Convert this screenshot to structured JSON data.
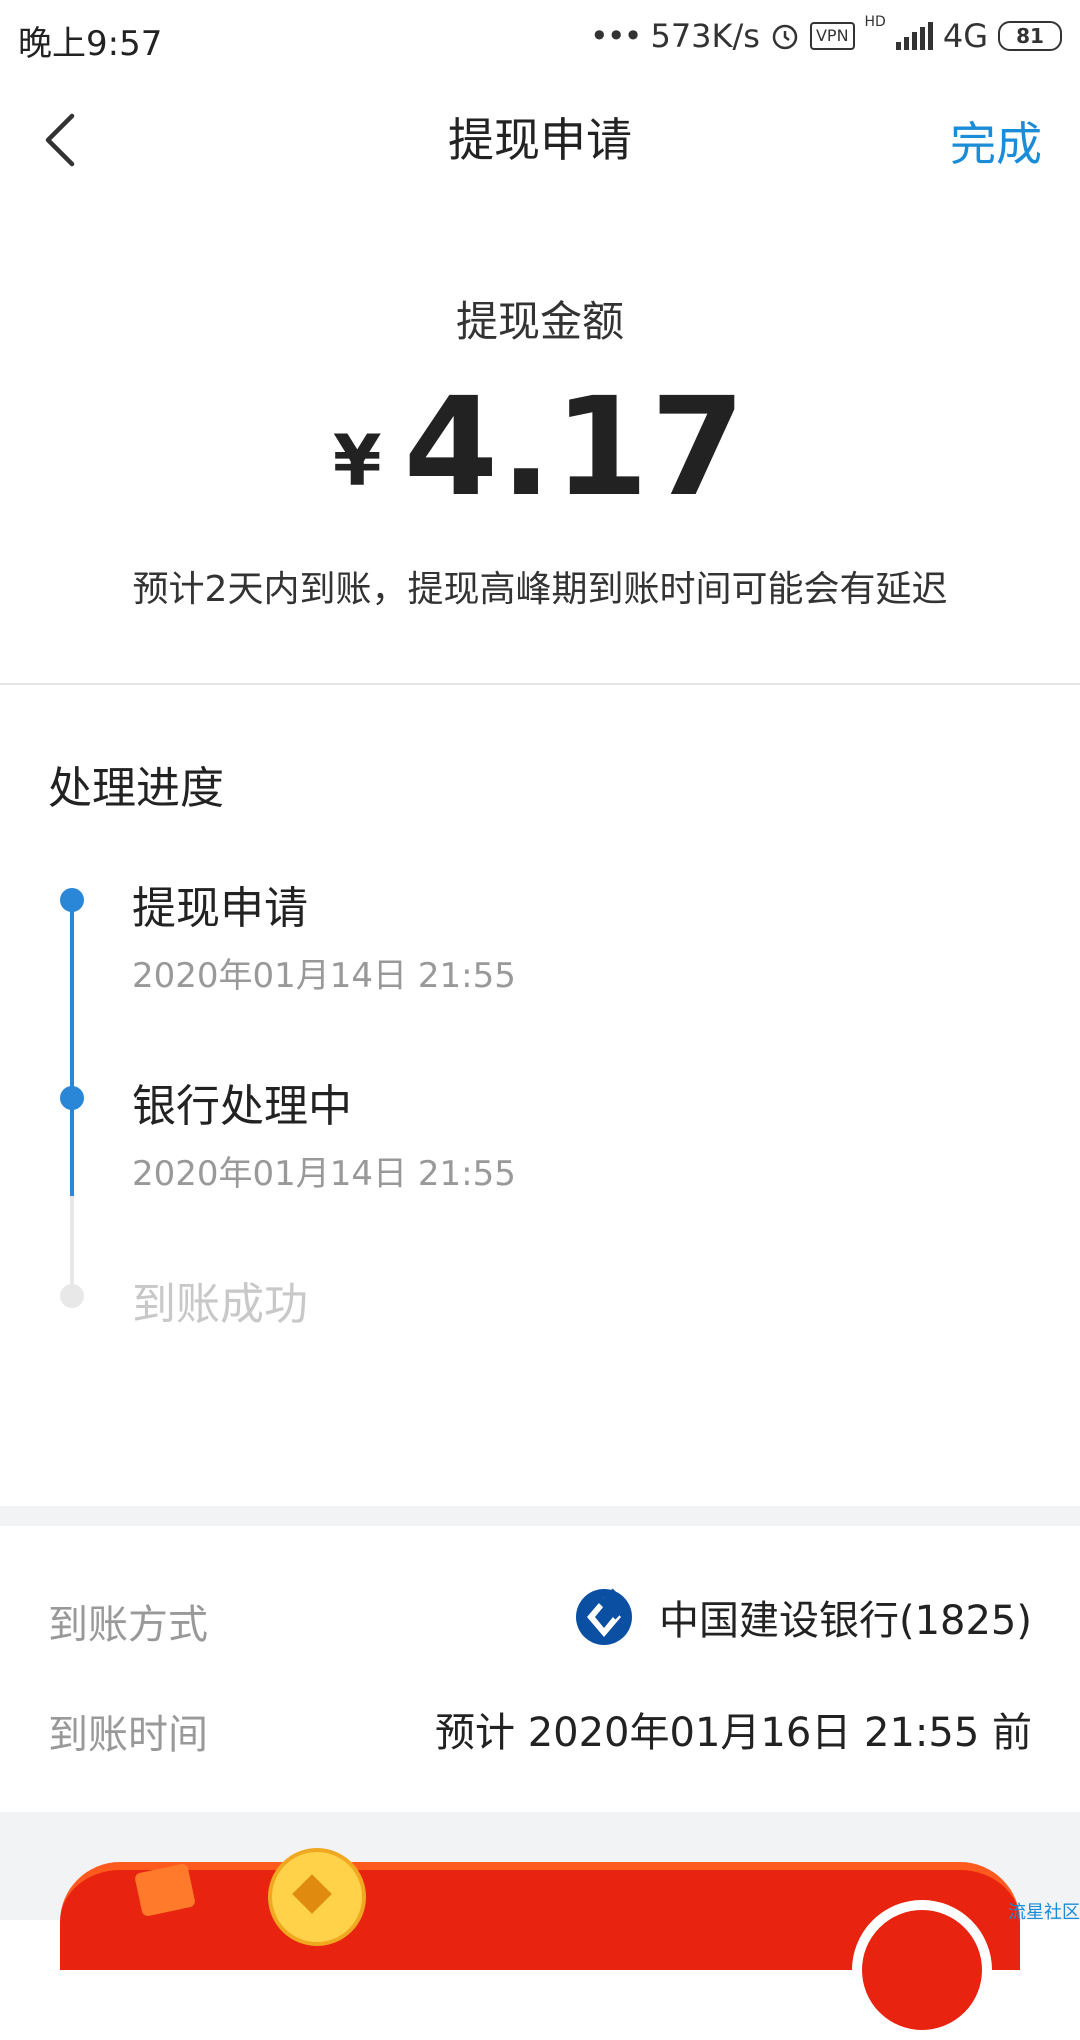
{
  "status_bar": {
    "time": "晚上9:57",
    "speed": "573K/s",
    "vpn": "VPN",
    "hd": "HD",
    "network": "4G",
    "battery": "81"
  },
  "nav": {
    "title": "提现申请",
    "done_label": "完成"
  },
  "amount": {
    "label": "提现金额",
    "currency": "¥",
    "value": "4.17",
    "note": "预计2天内到账，提现高峰期到账时间可能会有延迟"
  },
  "progress": {
    "title": "处理进度",
    "steps": [
      {
        "label": "提现申请",
        "time": "2020年01月14日 21:55",
        "status": "done"
      },
      {
        "label": "银行处理中",
        "time": "2020年01月14日 21:55",
        "status": "done"
      },
      {
        "label": "到账成功",
        "time": "",
        "status": "pending"
      }
    ]
  },
  "details": {
    "method_label": "到账方式",
    "method_value": "中国建设银行(1825)",
    "method_icon": "ccb-bank-icon",
    "time_label": "到账时间",
    "time_value": "预计 2020年01月16日 21:55 前"
  },
  "watermark": "流星社区",
  "colors": {
    "accent": "#1a8cd8",
    "timeline_active": "#2a86d6",
    "banner_red": "#e8230f"
  }
}
